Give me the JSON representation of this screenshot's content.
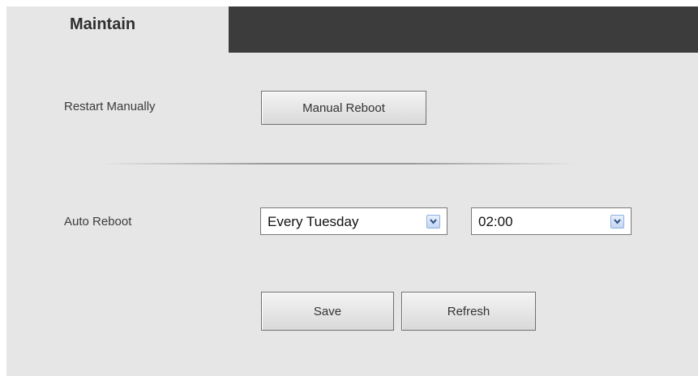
{
  "tab": {
    "label": "Maintain"
  },
  "restart": {
    "label": "Restart Manually",
    "button_label": "Manual Reboot"
  },
  "auto_reboot": {
    "label": "Auto Reboot",
    "day_value": "Every Tuesday",
    "time_value": "02:00"
  },
  "actions": {
    "save_label": "Save",
    "refresh_label": "Refresh"
  },
  "icons": {
    "dropdown": "chevron-down-icon"
  },
  "colors": {
    "header_bar": "#3c3c3c",
    "panel_background": "#e6e6e6",
    "dropdown_accent": "#8eb1df"
  }
}
